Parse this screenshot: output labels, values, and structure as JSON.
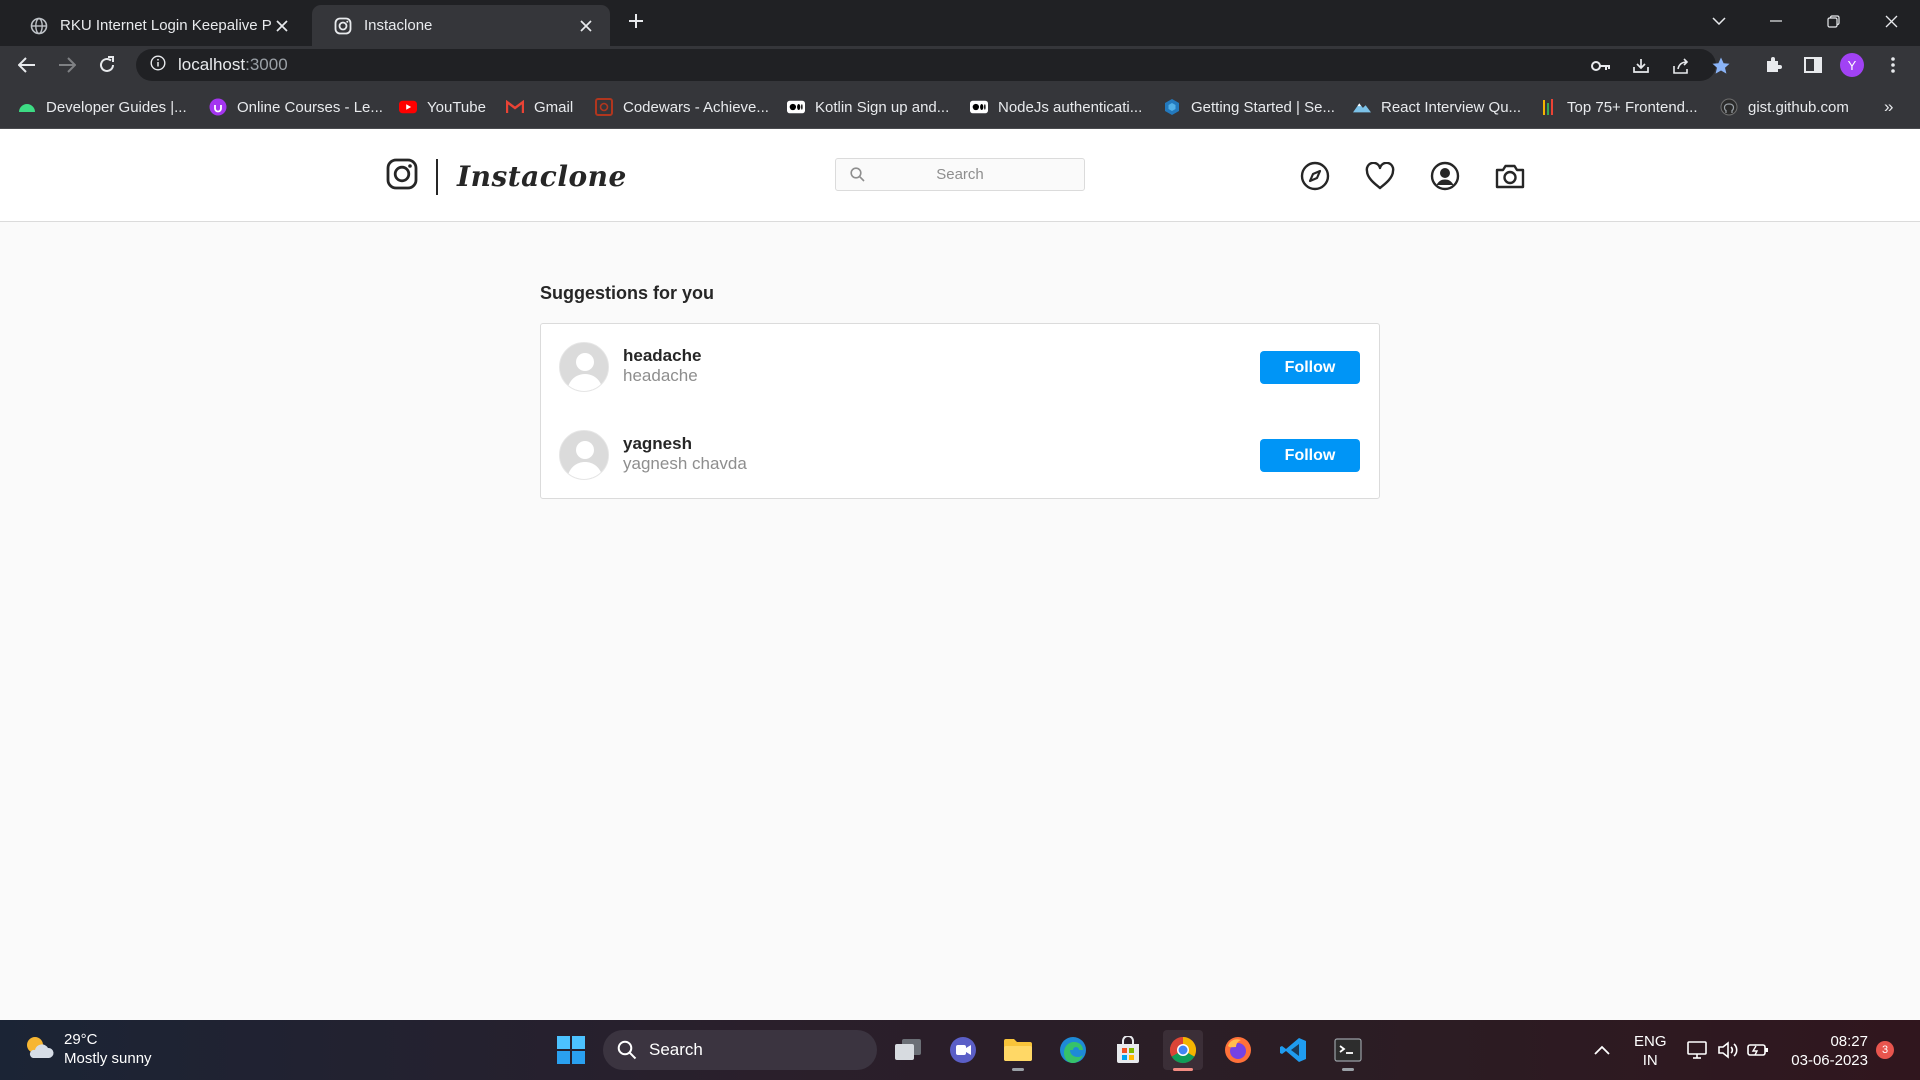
{
  "browser": {
    "tabs": [
      {
        "title": "RKU Internet Login Keepalive Pag",
        "icon": "globe-icon",
        "active": false
      },
      {
        "title": "Instaclone",
        "icon": "instagram-icon",
        "active": true
      }
    ],
    "address": {
      "host": "localhost",
      "port": ":3000"
    },
    "profile_initial": "Y",
    "bookmarks": [
      {
        "label": "Developer Guides |...",
        "icon": "android-icon",
        "color": "#3ddc84"
      },
      {
        "label": "Online Courses - Le...",
        "icon": "udemy-icon",
        "color": "#a435f0"
      },
      {
        "label": "YouTube",
        "icon": "youtube-icon",
        "color": "#ff0000"
      },
      {
        "label": "Gmail",
        "icon": "gmail-icon",
        "color": "#ea4335"
      },
      {
        "label": "Codewars - Achieve...",
        "icon": "codewars-icon",
        "color": "#b1361e"
      },
      {
        "label": "Kotlin Sign up and...",
        "icon": "medium-icon",
        "color": "#ffffff"
      },
      {
        "label": "NodeJs authenticati...",
        "icon": "medium-icon",
        "color": "#ffffff"
      },
      {
        "label": "Getting Started | Se...",
        "icon": "sequelize-icon",
        "color": "#2379bd"
      },
      {
        "label": "React Interview Qu...",
        "icon": "mountain-icon",
        "color": "#7cc2e8"
      },
      {
        "label": "Top 75+ Frontend...",
        "icon": "bars-icon",
        "color": "#f4b400"
      },
      {
        "label": "gist.github.com",
        "icon": "github-icon",
        "color": "#ffffff"
      }
    ],
    "more_bookmarks": "»"
  },
  "app": {
    "brand": "Instaclone",
    "search_placeholder": "Search",
    "nav_icons": [
      "compass-icon",
      "heart-icon",
      "user-circle-icon",
      "camera-icon"
    ],
    "suggestions_title": "Suggestions for you",
    "suggestions": [
      {
        "username": "headache",
        "full_name": "headache",
        "button": "Follow"
      },
      {
        "username": "yagnesh",
        "full_name": "yagnesh chavda",
        "button": "Follow"
      }
    ],
    "accent_color": "#0095f6"
  },
  "taskbar": {
    "weather": {
      "temp": "29°C",
      "condition": "Mostly sunny"
    },
    "search_label": "Search",
    "language": {
      "line1": "ENG",
      "line2": "IN"
    },
    "clock": {
      "time": "08:27",
      "date": "03-06-2023"
    },
    "notification_count": "3"
  }
}
